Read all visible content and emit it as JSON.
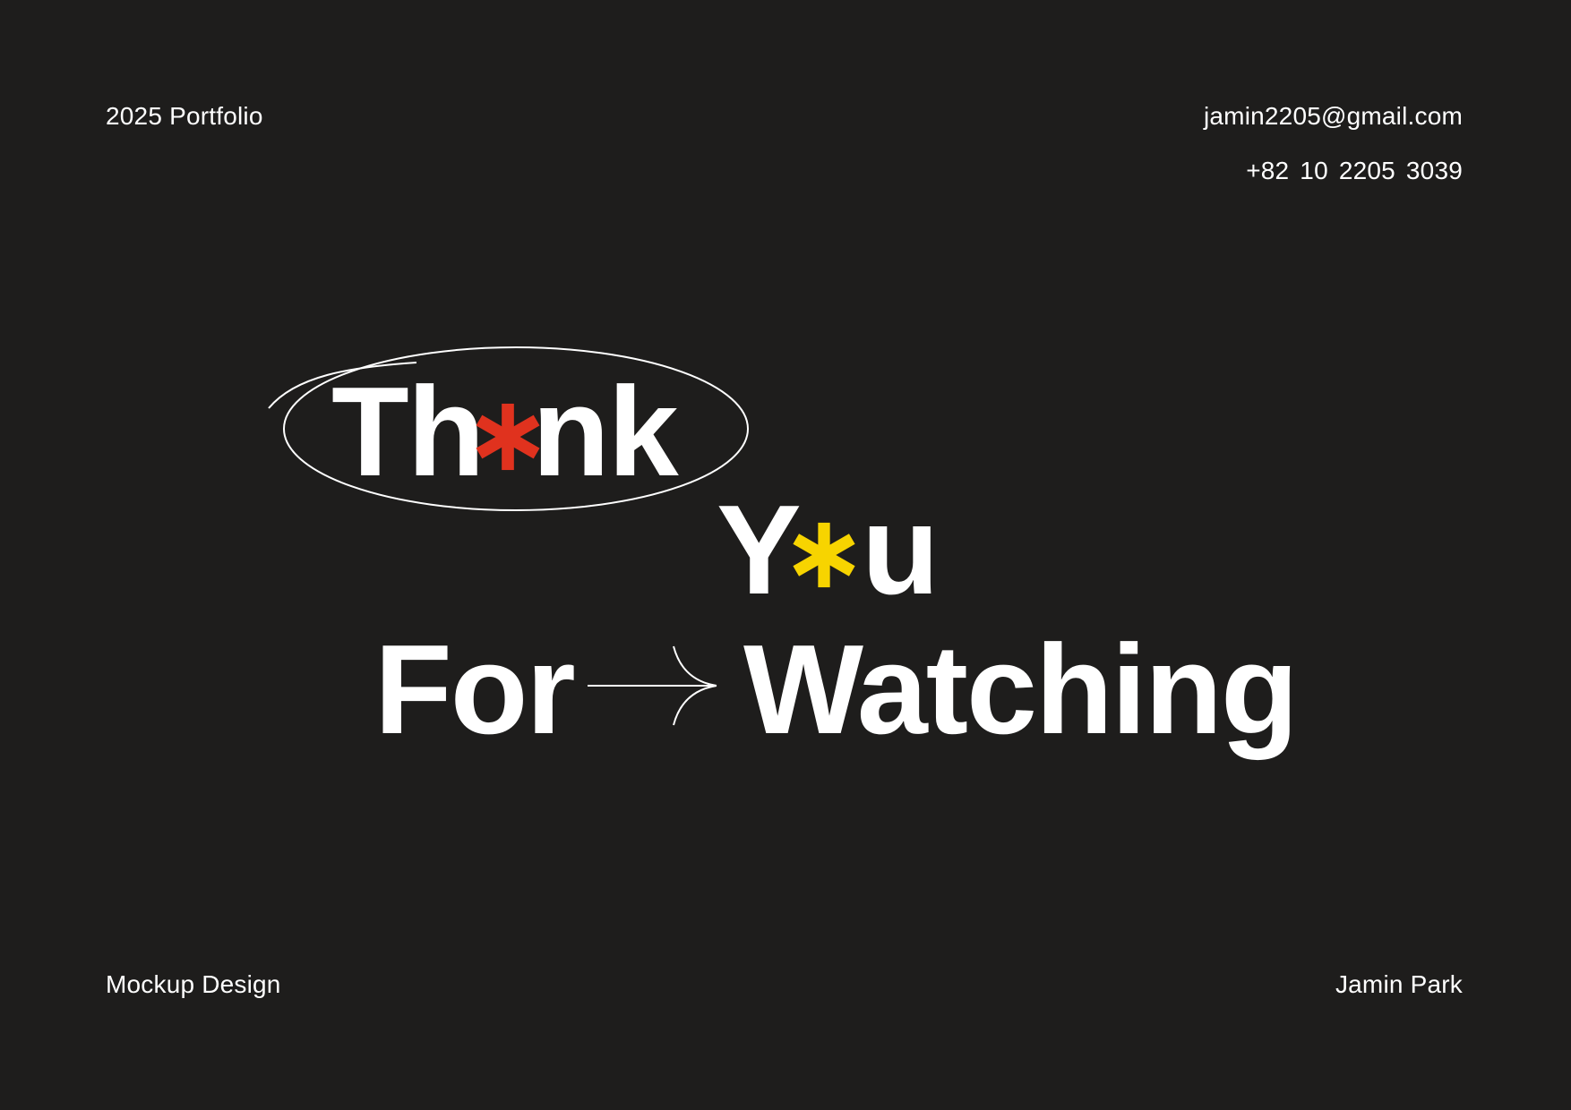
{
  "header": {
    "left_label": "2025 Portfolio",
    "email": "jamin2205@gmail.com",
    "phone": "+82 10  2205  3039"
  },
  "footer": {
    "left_label": "Mockup Design",
    "author": "Jamin Park"
  },
  "headline": {
    "line1_prefix": "Th",
    "line1_suffix": "nk",
    "line2_prefix": "Y",
    "line2_suffix": "u",
    "line3_left": "For",
    "line3_right": "Watching"
  },
  "colors": {
    "background": "#1e1d1c",
    "text": "#ffffff",
    "asterisk_red": "#e0321e",
    "asterisk_yellow": "#f7d400"
  },
  "icons": {
    "line1_glyph": "asterisk-icon",
    "line2_glyph": "asterisk-icon",
    "connector": "arrow-right-icon",
    "highlight": "ellipse-outline"
  }
}
